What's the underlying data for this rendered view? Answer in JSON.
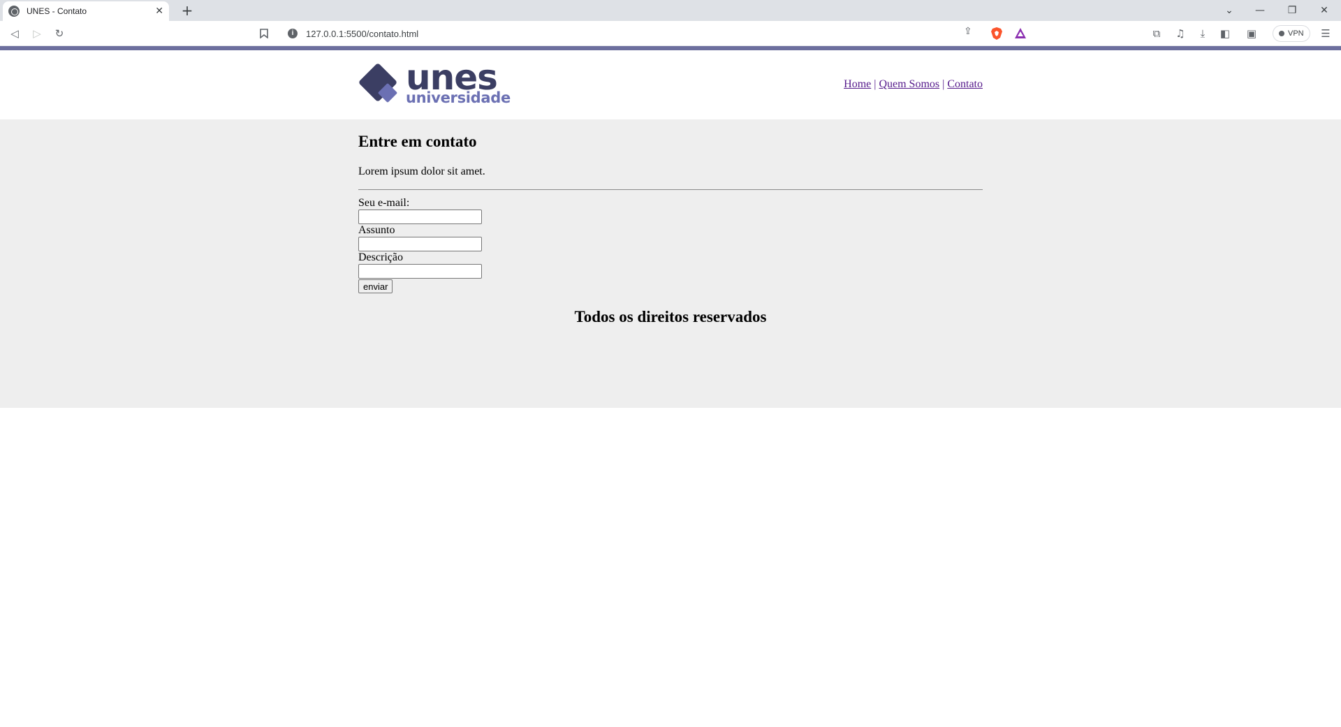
{
  "browser": {
    "tab_title": "UNES - Contato",
    "tab_close": "✕",
    "new_tab": "+",
    "url": "127.0.0.1:5500/contato.html",
    "vpn_label": "VPN",
    "window_controls": [
      "⌄",
      "—",
      "❐",
      "✕"
    ],
    "nav_buttons": {
      "back": "◁",
      "forward": "▷",
      "reload": "↻"
    },
    "bookmark": "🔖",
    "toolbar_icons": [
      "extensions-icon",
      "music-icon",
      "download-icon",
      "sidebar-icon",
      "wallet-icon",
      "menu-icon"
    ]
  },
  "site": {
    "logo_word": "unes",
    "logo_sub": "universidade",
    "nav": [
      {
        "label": "Home"
      },
      {
        "label": "Quem Somos"
      },
      {
        "label": "Contato"
      }
    ],
    "nav_separator": "|"
  },
  "main": {
    "title": "Entre em contato",
    "lead": "Lorem ipsum dolor sit amet.",
    "form": {
      "email_label": "Seu e-mail:",
      "email_value": "",
      "subject_label": "Assunto",
      "subject_value": "",
      "description_label": "Descrição",
      "description_value": "",
      "submit_label": "enviar"
    },
    "footer": "Todos os direitos reservados"
  },
  "colors": {
    "accent_bar": "#6c6f9e",
    "logo_dark": "#3b3e63",
    "logo_light": "#6b70b3",
    "band": "#eeeeee",
    "visited_link": "#551a8b"
  }
}
